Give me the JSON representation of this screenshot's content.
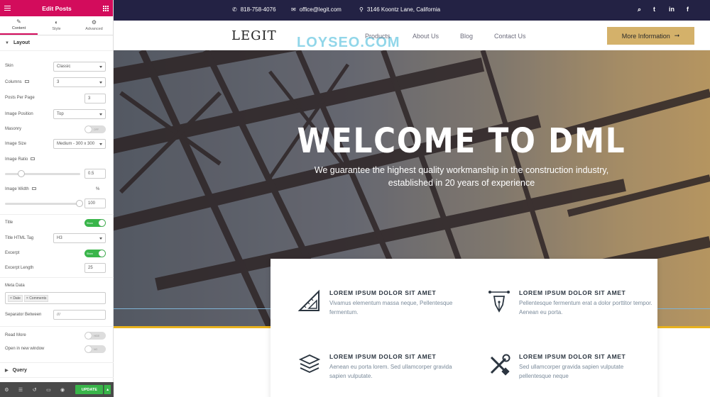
{
  "editor": {
    "title": "Edit Posts",
    "tabs": [
      {
        "label": "Content",
        "icon": "pencil-icon"
      },
      {
        "label": "Style",
        "icon": "half-circle-icon"
      },
      {
        "label": "Advanced",
        "icon": "gear-icon"
      }
    ],
    "sections": {
      "layout": "Layout",
      "query": "Query"
    },
    "controls": {
      "skin": {
        "label": "Skin",
        "value": "Classic"
      },
      "columns": {
        "label": "Columns",
        "value": "3"
      },
      "posts_per_page": {
        "label": "Posts Per Page",
        "value": "3"
      },
      "image_position": {
        "label": "Image Position",
        "value": "Top"
      },
      "masonry": {
        "label": "Masonry",
        "toggle_text": "OFF"
      },
      "image_size": {
        "label": "Image Size",
        "value": "Medium - 300 x 300"
      },
      "image_ratio": {
        "label": "Image Ratio",
        "value": "0.5"
      },
      "image_width": {
        "label": "Image Width",
        "unit": "%",
        "value": "100"
      },
      "title": {
        "label": "Title",
        "toggle_text": "Show"
      },
      "title_html_tag": {
        "label": "Title HTML Tag",
        "value": "H3"
      },
      "excerpt": {
        "label": "Excerpt",
        "toggle_text": "Show"
      },
      "excerpt_length": {
        "label": "Excerpt Length",
        "value": "25"
      },
      "meta_data": {
        "label": "Meta Data",
        "tags": [
          "Date",
          "Comments"
        ]
      },
      "separator_between": {
        "label": "Separator Between",
        "placeholder": "///"
      },
      "read_more": {
        "label": "Read More",
        "toggle_text": "HIDE"
      },
      "open_new_window": {
        "label": "Open in new window",
        "toggle_text": "NO"
      }
    },
    "footer": {
      "update_label": "UPDATE"
    }
  },
  "site": {
    "topbar": {
      "phone": "818-758-4076",
      "email": "office@legit.com",
      "address": "3146 Koontz Lane, California"
    },
    "logo": "LEGIT",
    "watermark": "LOYSEO.COM",
    "nav": [
      "Products",
      "About Us",
      "Blog",
      "Contact Us"
    ],
    "cta": "More Information",
    "hero": {
      "title": "WELCOME TO DML",
      "subtitle": "We guarantee the highest quality workmanship in the construction industry, established in 20 years of experience"
    },
    "features": [
      {
        "title": "LOREM IPSUM DOLOR SIT AMET",
        "text": "Vivamus elementum massa neque, Pellentesque fermentum.",
        "icon": "ruler-triangle-icon"
      },
      {
        "title": "LOREM IPSUM DOLOR SIT AMET",
        "text": "Pellentesque fermentum erat a dolor porttitor tempor. Aenean eu porta.",
        "icon": "pen-nib-icon"
      },
      {
        "title": "LOREM IPSUM DOLOR SIT AMET",
        "text": "Aenean eu porta lorem. Sed ullamcorper gravida sapien vulputate.",
        "icon": "layers-icon"
      },
      {
        "title": "LOREM IPSUM DOLOR SIT AMET",
        "text": "Sed ullamcorper gravida sapien vulputate pellentesque neque",
        "icon": "wrench-screwdriver-icon"
      }
    ]
  },
  "colors": {
    "editor_accent": "#d30c5c",
    "topbar_bg": "#232244",
    "cta_bg": "#d4b16a",
    "accent_yellow": "#e8b21e",
    "update_green": "#39b54a"
  }
}
